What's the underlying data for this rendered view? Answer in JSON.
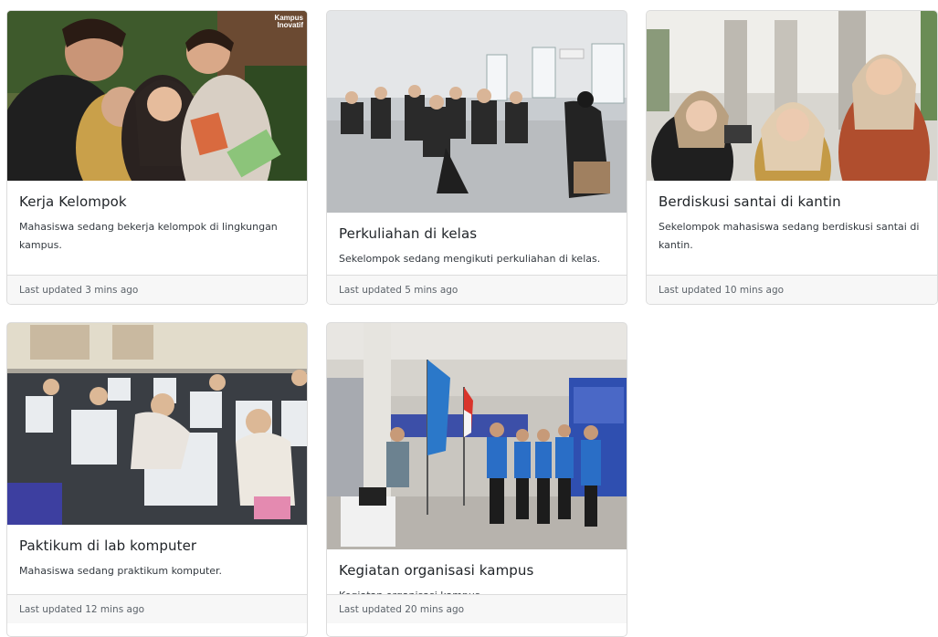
{
  "cards": [
    {
      "title": "Kerja Kelompok",
      "text": "Mahasiswa sedang bekerja kelompok di lingkungan kampus.",
      "footer": "Last updated 3 mins ago",
      "logo_line1": "Kampus",
      "logo_line2": "Inovatif"
    },
    {
      "title": "Perkuliahan di kelas",
      "text": "Sekelompok sedang mengikuti perkuliahan di kelas.",
      "footer": "Last updated 5 mins ago"
    },
    {
      "title": "Berdiskusi santai di kantin",
      "text": "Sekelompok mahasiswa sedang berdiskusi santai di kantin.",
      "footer": "Last updated 10 mins ago"
    },
    {
      "title": "Paktikum di lab komputer",
      "text": "Mahasiswa sedang praktikum komputer.",
      "footer": "Last updated 12 mins ago"
    },
    {
      "title": "Kegiatan organisasi kampus",
      "text": "Kegiatan organisasi kampus.",
      "footer": "Last updated 20 mins ago"
    }
  ]
}
